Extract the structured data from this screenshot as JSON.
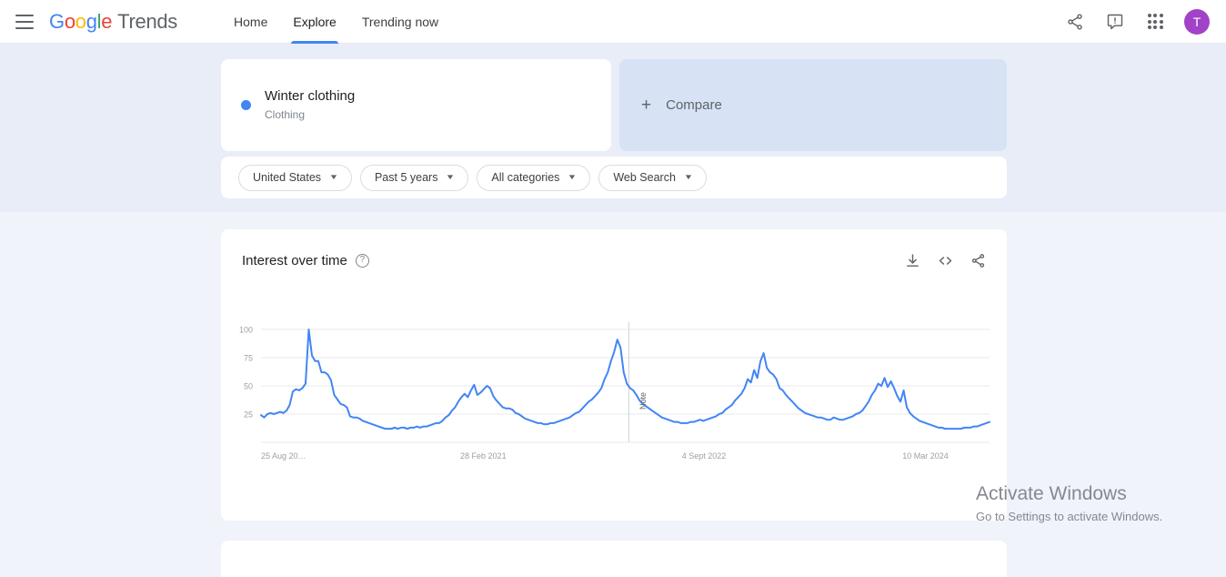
{
  "header": {
    "menu_icon": "hamburger-icon",
    "brand": {
      "g1": "G",
      "o1": "o",
      "o2": "o",
      "g2": "g",
      "l": "l",
      "e": "e",
      "product": "Trends"
    },
    "nav": [
      {
        "label": "Home",
        "active": false
      },
      {
        "label": "Explore",
        "active": true
      },
      {
        "label": "Trending now",
        "active": false
      }
    ],
    "actions": [
      {
        "icon": "share-icon"
      },
      {
        "icon": "feedback-icon"
      },
      {
        "icon": "apps-grid-icon"
      }
    ],
    "avatar_initial": "T"
  },
  "query": {
    "term": "Winter clothing",
    "category": "Clothing",
    "marker_color": "#4285F4"
  },
  "compare": {
    "label": "Compare",
    "plus": "+"
  },
  "filters": [
    {
      "label": "United States",
      "caret": "▼"
    },
    {
      "label": "Past 5 years",
      "caret": "▼"
    },
    {
      "label": "All categories",
      "caret": "▼"
    },
    {
      "label": "Web Search",
      "caret": "▼"
    }
  ],
  "interest_over_time": {
    "title": "Interest over time",
    "help": "?",
    "actions": [
      {
        "icon": "download-icon"
      },
      {
        "icon": "embed-code-icon"
      },
      {
        "icon": "share-icon"
      }
    ]
  },
  "watermark": {
    "title": "Activate Windows",
    "subtitle": "Go to Settings to activate Windows."
  },
  "chart_data": {
    "type": "line",
    "title": "Interest over time",
    "xlabel": "",
    "ylabel": "",
    "ylim": [
      0,
      100
    ],
    "yticks": [
      25,
      50,
      75,
      100
    ],
    "ytick_labels": [
      "25",
      "50",
      "75",
      "100"
    ],
    "grid": true,
    "legend": false,
    "line_color": "#4285F4",
    "series_name": "Winter clothing",
    "xtick_labels": [
      "25 Aug 20…",
      "28 Feb 2021",
      "4 Sept 2022",
      "10 Mar 2024"
    ],
    "xtick_positions": [
      0,
      0.305,
      0.608,
      0.912
    ],
    "annotation": {
      "text": "Note",
      "position": 0.505
    },
    "values": [
      24,
      22,
      25,
      26,
      25,
      26,
      27,
      26,
      28,
      33,
      45,
      47,
      46,
      48,
      52,
      100,
      77,
      72,
      72,
      62,
      62,
      60,
      55,
      42,
      38,
      34,
      33,
      31,
      23,
      22,
      22,
      21,
      19,
      18,
      17,
      16,
      15,
      14,
      13,
      12,
      12,
      12,
      13,
      12,
      13,
      13,
      12,
      13,
      13,
      14,
      13,
      14,
      14,
      15,
      16,
      17,
      17,
      19,
      22,
      24,
      28,
      31,
      36,
      40,
      43,
      40,
      46,
      51,
      42,
      44,
      47,
      50,
      48,
      41,
      37,
      34,
      31,
      30,
      30,
      29,
      26,
      25,
      23,
      21,
      20,
      19,
      18,
      17,
      17,
      16,
      16,
      17,
      17,
      18,
      19,
      20,
      21,
      22,
      24,
      26,
      27,
      30,
      33,
      36,
      38,
      41,
      44,
      48,
      56,
      62,
      72,
      80,
      91,
      84,
      62,
      52,
      48,
      46,
      42,
      37,
      34,
      32,
      30,
      28,
      26,
      24,
      22,
      21,
      20,
      19,
      18,
      18,
      17,
      17,
      17,
      18,
      18,
      19,
      20,
      19,
      20,
      21,
      22,
      23,
      25,
      26,
      29,
      31,
      33,
      37,
      40,
      43,
      48,
      56,
      53,
      64,
      57,
      72,
      79,
      66,
      62,
      60,
      56,
      48,
      46,
      42,
      39,
      36,
      33,
      30,
      28,
      26,
      25,
      24,
      23,
      22,
      22,
      21,
      20,
      20,
      22,
      21,
      20,
      20,
      21,
      22,
      23,
      25,
      26,
      28,
      32,
      36,
      42,
      46,
      52,
      50,
      57,
      49,
      54,
      48,
      41,
      36,
      46,
      31,
      26,
      23,
      21,
      19,
      18,
      17,
      16,
      15,
      14,
      13,
      13,
      12,
      12,
      12,
      12,
      12,
      12,
      13,
      13,
      13,
      14,
      14,
      15,
      16,
      17,
      18
    ]
  }
}
